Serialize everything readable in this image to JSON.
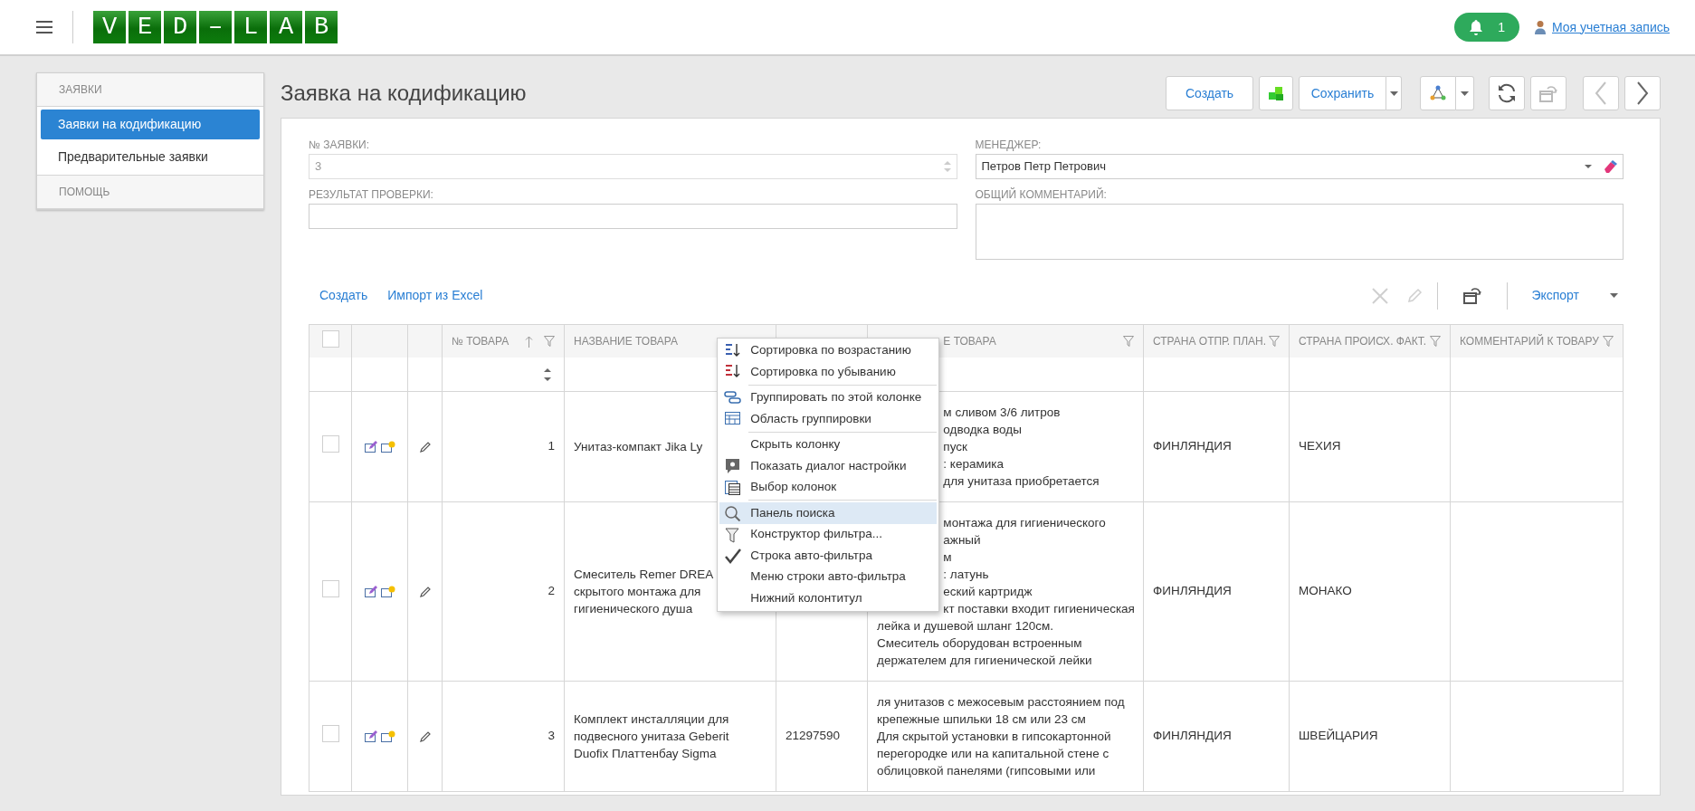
{
  "header": {
    "logo_text": "VED–LAB",
    "notifications": "1",
    "account_link": "Моя учетная запись"
  },
  "sidebar": {
    "sections": [
      {
        "title": "ЗАЯВКИ",
        "items": [
          {
            "label": "Заявки на кодификацию",
            "selected": true
          },
          {
            "label": "Предварительные заявки",
            "selected": false
          }
        ]
      },
      {
        "title": "ПОМОЩЬ"
      }
    ]
  },
  "page": {
    "title": "Заявка на кодификацию",
    "toolbar": [
      {
        "kind": "text",
        "label": "Создать",
        "disabled": false
      },
      {
        "kind": "cubes",
        "disabled": false
      },
      {
        "kind": "split",
        "label": "Сохранить",
        "disabled": false
      },
      {
        "kind": "graph",
        "disabled": false
      },
      {
        "kind": "refresh",
        "disabled": false
      },
      {
        "kind": "restore",
        "disabled": true
      },
      {
        "kind": "prev",
        "disabled": true
      },
      {
        "kind": "next",
        "disabled": false
      }
    ]
  },
  "form": {
    "fields": [
      {
        "kind": "number",
        "label": "№ ЗАЯВКИ:",
        "value": "3",
        "disabled": true
      },
      {
        "kind": "select",
        "label": "МЕНЕДЖЕР:",
        "value": "Петров Петр Петрович",
        "disabled": false
      },
      {
        "kind": "text",
        "label": "РЕЗУЛЬТАТ ПРОВЕРКИ:",
        "disabled": false
      },
      {
        "kind": "textarea",
        "label": "ОБЩИЙ КОММЕНТАРИЙ:",
        "disabled": false
      }
    ]
  },
  "grid_toolbar": {
    "links": [
      "Создать",
      "Импорт из Excel"
    ],
    "tools": [
      {
        "kind": "delete",
        "disabled": true
      },
      {
        "kind": "edit",
        "disabled": true
      },
      {
        "kind": "restore",
        "disabled": false
      }
    ],
    "export": "Экспорт"
  },
  "table": {
    "select_all_checked": false,
    "columns": [
      {
        "kind": "select"
      },
      {
        "kind": "actions"
      },
      {
        "kind": "edit"
      },
      {
        "kind": "number",
        "label": "№ ТОВАРА",
        "sort_ascending": true,
        "filter": true
      },
      {
        "kind": "name",
        "label": "НАЗВАНИЕ ТОВАРА",
        "filter": false
      },
      {
        "kind": "code",
        "filter": false
      },
      {
        "kind": "description",
        "label": "Е ТОВАРА",
        "filter": true
      },
      {
        "kind": "ship",
        "label": "СТРАНА ОТПР. ПЛАН.",
        "filter": true
      },
      {
        "kind": "origin",
        "label": "СТРАНА ПРОИСХ. ФАКТ.",
        "filter": true
      },
      {
        "kind": "comment",
        "label": "КОММЕНТАРИЙ К ТОВАРУ",
        "filter": true
      }
    ],
    "rows": [
      {
        "checked": false,
        "number": "1",
        "name": [
          "Унитаз-компакт Jika Ly"
        ],
        "description": [
          "м сливом 3/6 литров",
          "одводка воды",
          "пуск",
          ": керамика",
          "для унитаза приобретается"
        ],
        "ship": "ФИНЛЯНДИЯ",
        "origin": "ЧЕХИЯ"
      },
      {
        "checked": false,
        "number": "2",
        "name": [
          "Смеситель Remer DREA",
          "скрытого монтажа для",
          "гигиенического душа"
        ],
        "description": [
          "монтажа для гигиенического",
          "ажный",
          "м",
          ": латунь",
          "еский картридж",
          "кт поставки входит гигиеническая",
          "лейка и душевой шланг 120см.",
          "Смеситель оборудован встроенным",
          "держателем для гигиенической лейки"
        ],
        "ship": "ФИНЛЯНДИЯ",
        "origin": "МОНАКО"
      },
      {
        "checked": false,
        "number": "3",
        "name": [
          "Комплект инсталляции для",
          "подвесного унитаза Geberit",
          "Duofix Платтенбау Sigma"
        ],
        "code": "21297590",
        "description": [
          "ля унитазов с межосевым расстоянием под",
          "крепежные шпильки 18 см или 23 см",
          "Для скрытой установки в гипсокартонной",
          "перегородке или на капитальной стене с",
          "облицовкой панелями (гипсовыми или"
        ],
        "ship": "ФИНЛЯНДИЯ",
        "origin": "ШВЕЙЦАРИЯ"
      }
    ]
  },
  "context_menu": {
    "groups": [
      [
        {
          "kind": "ascending",
          "label": "Сортировка по возрастанию",
          "selected": false
        },
        {
          "kind": "descending",
          "label": "Сортировка по убыванию",
          "selected": false
        }
      ],
      [
        {
          "kind": "group",
          "label": "Группировать по этой колонке",
          "selected": false
        },
        {
          "kind": "grouppanel",
          "label": "Область группировки",
          "selected": false
        }
      ],
      [
        {
          "kind": "plain",
          "label": "Скрыть колонку",
          "selected": false
        },
        {
          "kind": "dialog",
          "label": "Показать диалог настройки",
          "selected": false
        },
        {
          "kind": "columns",
          "label": "Выбор колонок",
          "selected": false
        }
      ],
      [
        {
          "kind": "search",
          "label": "Панель поиска",
          "selected": true
        },
        {
          "kind": "filter",
          "label": "Конструктор фильтра...",
          "selected": false
        },
        {
          "kind": "toggle",
          "label": "Строка авто-фильтра",
          "selected": false,
          "checked": true
        },
        {
          "kind": "toggle",
          "label": "Меню строки авто-фильтра",
          "selected": false,
          "checked": false
        },
        {
          "kind": "toggle",
          "label": "Нижний колонтитул",
          "selected": false,
          "checked": false
        }
      ]
    ]
  }
}
